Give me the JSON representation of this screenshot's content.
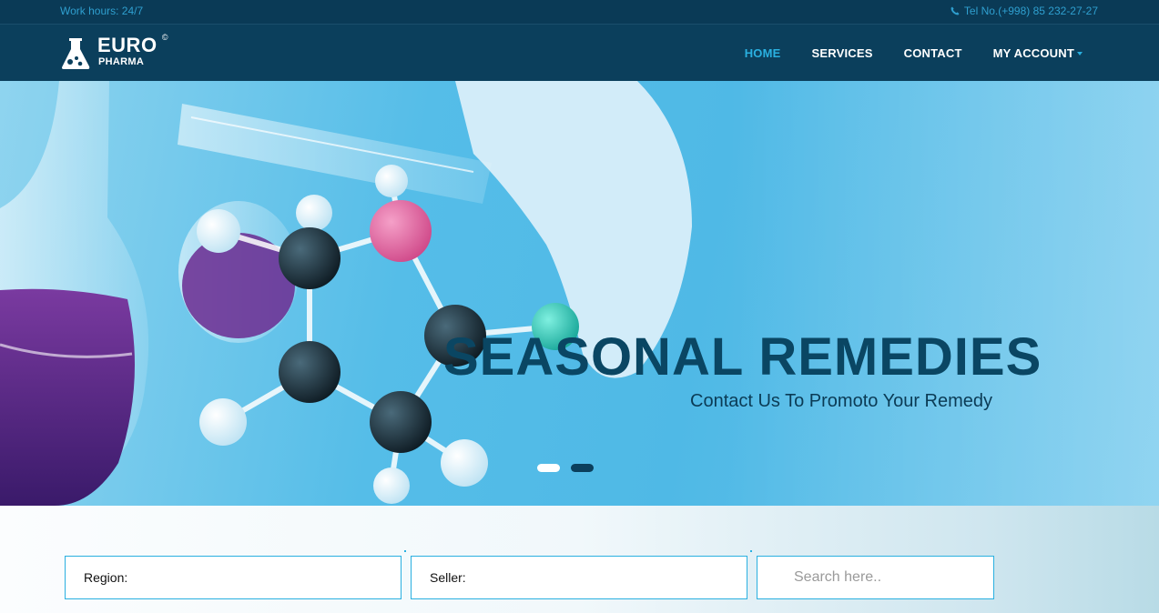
{
  "topbar": {
    "work_hours": "Work hours: 24/7",
    "phone": "Tel No.(+998) 85 232-27-27",
    "phone_icon": "phone-icon"
  },
  "logo": {
    "euro": "EURO",
    "pharma": "PHARMA",
    "mark": "©",
    "icon": "flask-icon"
  },
  "nav": {
    "items": [
      {
        "label": "HOME",
        "active": true
      },
      {
        "label": "SERVICES",
        "active": false
      },
      {
        "label": "CONTACT",
        "active": false
      },
      {
        "label": "MY ACCOUNT",
        "active": false
      }
    ]
  },
  "hero": {
    "title": "SEASONAL REMEDIES",
    "subtitle": "Contact Us To Promoto Your Remedy",
    "slides": 2,
    "active_slide": 1
  },
  "filters": {
    "region_label": "Region:",
    "seller_label": "Seller:",
    "search_placeholder": "Search here.."
  },
  "colors": {
    "topbar": "#0a3a56",
    "navbar": "#0b3f5c",
    "accent": "#2ab0e0",
    "hero_title": "#0a4663"
  }
}
